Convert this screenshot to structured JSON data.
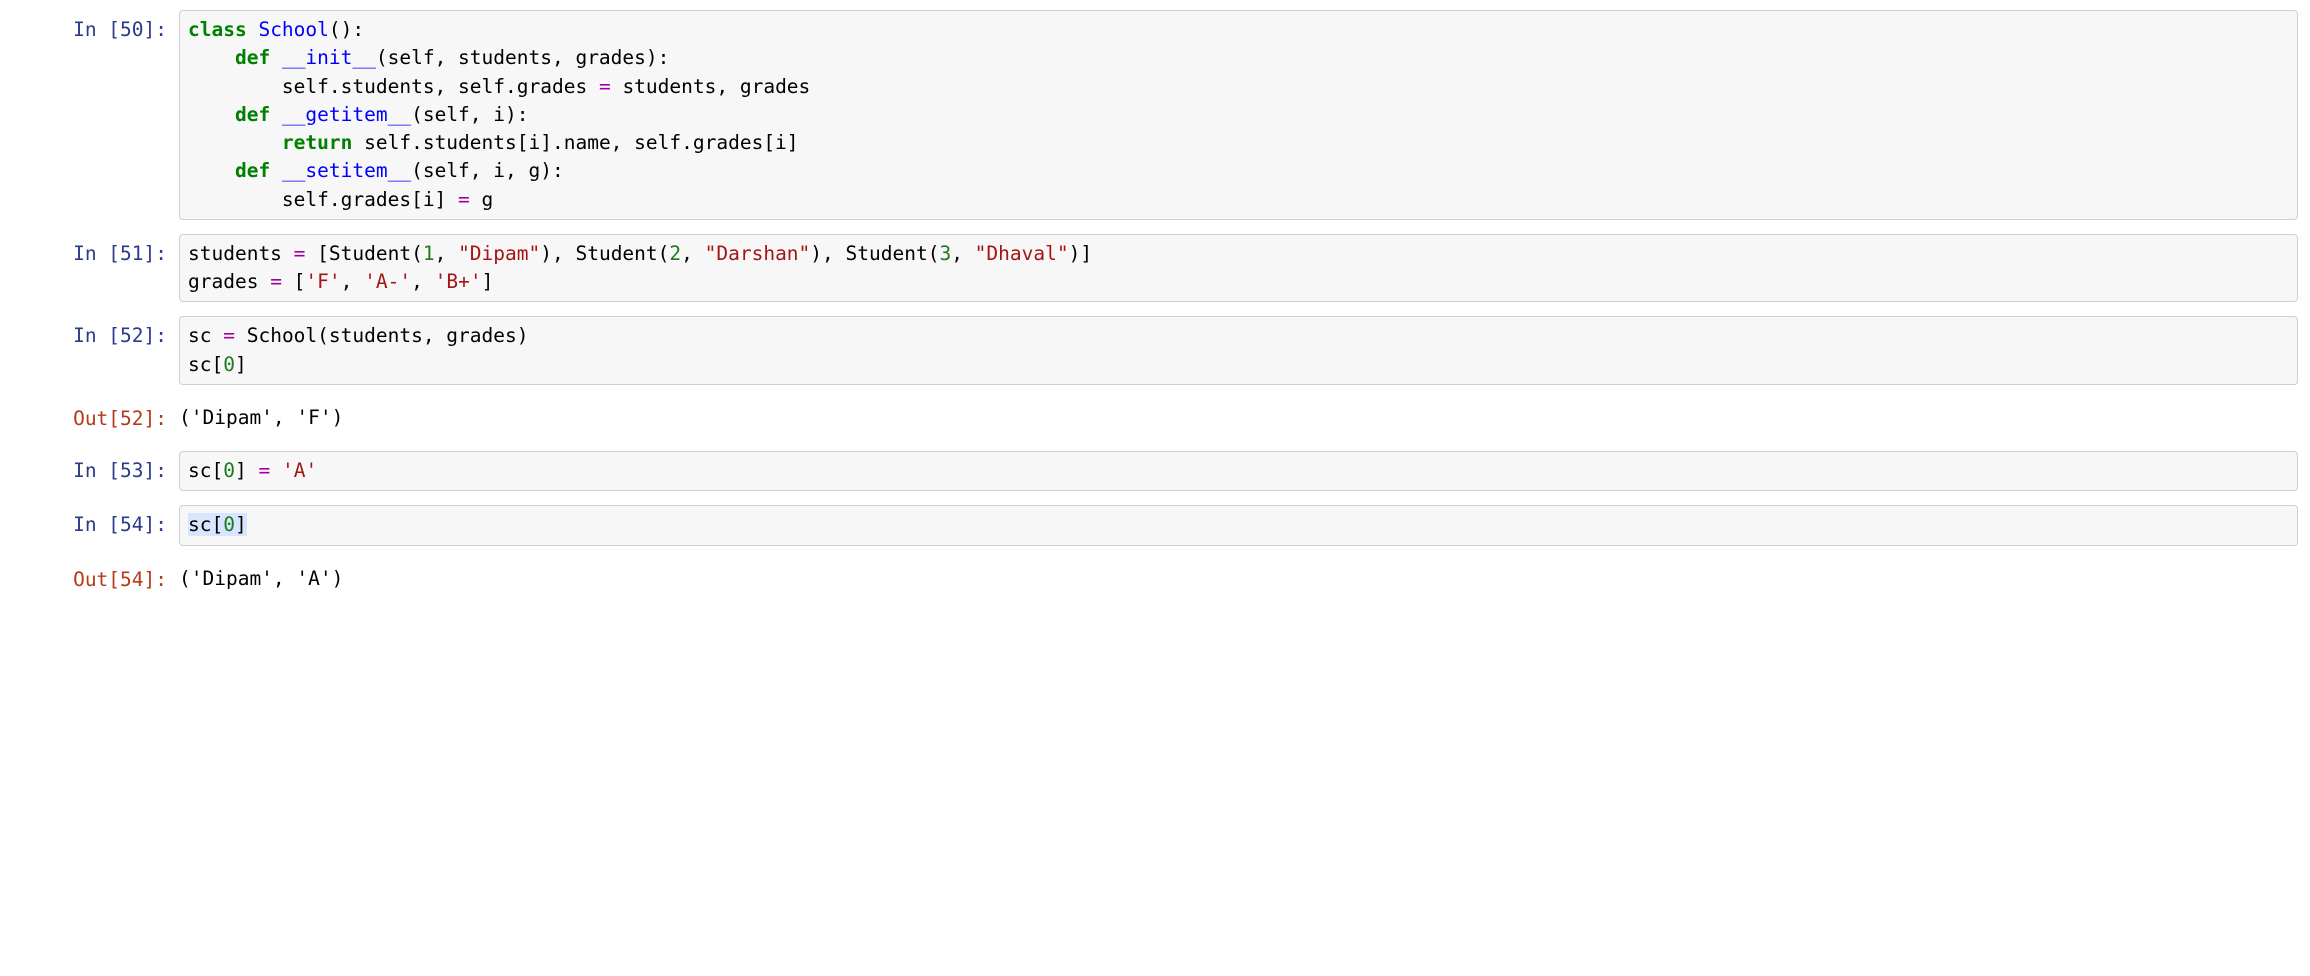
{
  "cells": [
    {
      "type": "in",
      "n": "50",
      "lines": [
        [
          {
            "t": "class",
            "c": "kw"
          },
          {
            "t": " "
          },
          {
            "t": "School",
            "c": "cls"
          },
          {
            "t": "():"
          }
        ],
        [
          {
            "t": "    "
          },
          {
            "t": "def",
            "c": "kw"
          },
          {
            "t": " "
          },
          {
            "t": "__init__",
            "c": "fn"
          },
          {
            "t": "(self, students, grades):"
          }
        ],
        [
          {
            "t": "        self"
          },
          {
            "t": "."
          },
          {
            "t": "students, self"
          },
          {
            "t": "."
          },
          {
            "t": "grades "
          },
          {
            "t": "=",
            "c": "op"
          },
          {
            "t": " students, grades"
          }
        ],
        [
          {
            "t": "    "
          },
          {
            "t": "def",
            "c": "kw"
          },
          {
            "t": " "
          },
          {
            "t": "__getitem__",
            "c": "fn"
          },
          {
            "t": "(self, i):"
          }
        ],
        [
          {
            "t": "        "
          },
          {
            "t": "return",
            "c": "kw"
          },
          {
            "t": " self"
          },
          {
            "t": "."
          },
          {
            "t": "students[i]"
          },
          {
            "t": "."
          },
          {
            "t": "name, self"
          },
          {
            "t": "."
          },
          {
            "t": "grades[i]"
          }
        ],
        [
          {
            "t": "    "
          },
          {
            "t": "def",
            "c": "kw"
          },
          {
            "t": " "
          },
          {
            "t": "__setitem__",
            "c": "fn"
          },
          {
            "t": "(self, i, g):"
          }
        ],
        [
          {
            "t": "        self"
          },
          {
            "t": "."
          },
          {
            "t": "grades[i] "
          },
          {
            "t": "=",
            "c": "op"
          },
          {
            "t": " g"
          }
        ]
      ]
    },
    {
      "type": "in",
      "n": "51",
      "lines": [
        [
          {
            "t": "students "
          },
          {
            "t": "=",
            "c": "op"
          },
          {
            "t": " [Student("
          },
          {
            "t": "1",
            "c": "num"
          },
          {
            "t": ", "
          },
          {
            "t": "\"Dipam\"",
            "c": "str"
          },
          {
            "t": "), Student("
          },
          {
            "t": "2",
            "c": "num"
          },
          {
            "t": ", "
          },
          {
            "t": "\"Darshan\"",
            "c": "str"
          },
          {
            "t": "), Student("
          },
          {
            "t": "3",
            "c": "num"
          },
          {
            "t": ", "
          },
          {
            "t": "\"Dhaval\"",
            "c": "str"
          },
          {
            "t": ")]"
          }
        ],
        [
          {
            "t": "grades "
          },
          {
            "t": "=",
            "c": "op"
          },
          {
            "t": " ["
          },
          {
            "t": "'F'",
            "c": "str"
          },
          {
            "t": ", "
          },
          {
            "t": "'A-'",
            "c": "str"
          },
          {
            "t": ", "
          },
          {
            "t": "'B+'",
            "c": "str"
          },
          {
            "t": "]"
          }
        ]
      ]
    },
    {
      "type": "in",
      "n": "52",
      "lines": [
        [
          {
            "t": "sc "
          },
          {
            "t": "=",
            "c": "op"
          },
          {
            "t": " School(students, grades)"
          }
        ],
        [
          {
            "t": "sc["
          },
          {
            "t": "0",
            "c": "num"
          },
          {
            "t": "]"
          }
        ]
      ]
    },
    {
      "type": "out",
      "n": "52",
      "lines": [
        [
          {
            "t": "('Dipam', 'F')"
          }
        ]
      ]
    },
    {
      "type": "in",
      "n": "53",
      "lines": [
        [
          {
            "t": "sc["
          },
          {
            "t": "0",
            "c": "num"
          },
          {
            "t": "] "
          },
          {
            "t": "=",
            "c": "op"
          },
          {
            "t": " "
          },
          {
            "t": "'A'",
            "c": "str"
          }
        ]
      ]
    },
    {
      "type": "in",
      "n": "54",
      "lines": [
        [
          {
            "t": "sc[",
            "c": "sel"
          },
          {
            "t": "0",
            "c": "num sel"
          },
          {
            "t": "]",
            "c": "sel"
          }
        ]
      ]
    },
    {
      "type": "out",
      "n": "54",
      "lines": [
        [
          {
            "t": "('Dipam', 'A')"
          }
        ]
      ]
    }
  ],
  "labels": {
    "in": "In ",
    "out": "Out"
  }
}
